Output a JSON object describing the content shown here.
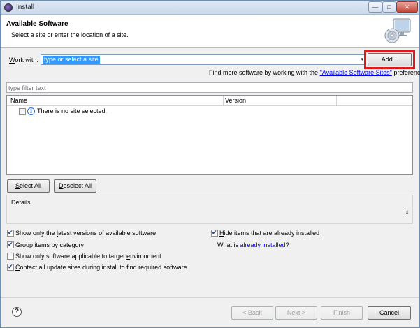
{
  "window": {
    "title": "Install",
    "min_glyph": "—",
    "max_glyph": "□",
    "close_glyph": "✕"
  },
  "header": {
    "title": "Available Software",
    "subtitle": "Select a site or enter the location of a site."
  },
  "work_with": {
    "label_pre": "W",
    "label_rest": "ork with:",
    "value": "type or select a site",
    "dropdown_glyph": "▾",
    "add_button": "Add..."
  },
  "find_more": {
    "text_before": "Find more software by working with the ",
    "link": "\"Available Software Sites\"",
    "text_after": " preferences."
  },
  "filter": {
    "placeholder": "type filter text"
  },
  "tree": {
    "columns": [
      "Name",
      "Version"
    ],
    "rows": [
      {
        "label": "There is no site selected.",
        "icon": "info-icon",
        "info_glyph": "i",
        "checked": false
      }
    ]
  },
  "selection_buttons": {
    "select_all_mn": "S",
    "select_all_rest": "elect All",
    "deselect_all_mn": "D",
    "deselect_all_rest": "eselect All"
  },
  "details": {
    "label": "Details",
    "scroll_glyph": "⇕"
  },
  "options": {
    "latest_pre": "Show only the ",
    "latest_mn": "l",
    "latest_post": "atest versions of available software",
    "latest_checked": true,
    "group_mn": "G",
    "group_post": "roup items by category",
    "group_checked": true,
    "target_pre": "Show only software applicable to target ",
    "target_mn": "e",
    "target_post": "nvironment",
    "target_checked": false,
    "contact_mn": "C",
    "contact_post": "ontact all update sites during install to find required software",
    "contact_checked": true,
    "hide_mn": "H",
    "hide_post": "ide items that are already installed",
    "hide_checked": true,
    "what_is_text": "What is ",
    "what_is_link": "already installed",
    "what_is_q": "?"
  },
  "footer": {
    "help_glyph": "?",
    "back": "< Back",
    "back_mn": "B",
    "next": "Next >",
    "finish": "Finish",
    "cancel": "Cancel",
    "back_enabled": false,
    "next_enabled": false,
    "finish_enabled": false
  },
  "colors": {
    "highlight_border": "#e0191b",
    "selection": "#3399ff",
    "link": "#0000ee"
  }
}
